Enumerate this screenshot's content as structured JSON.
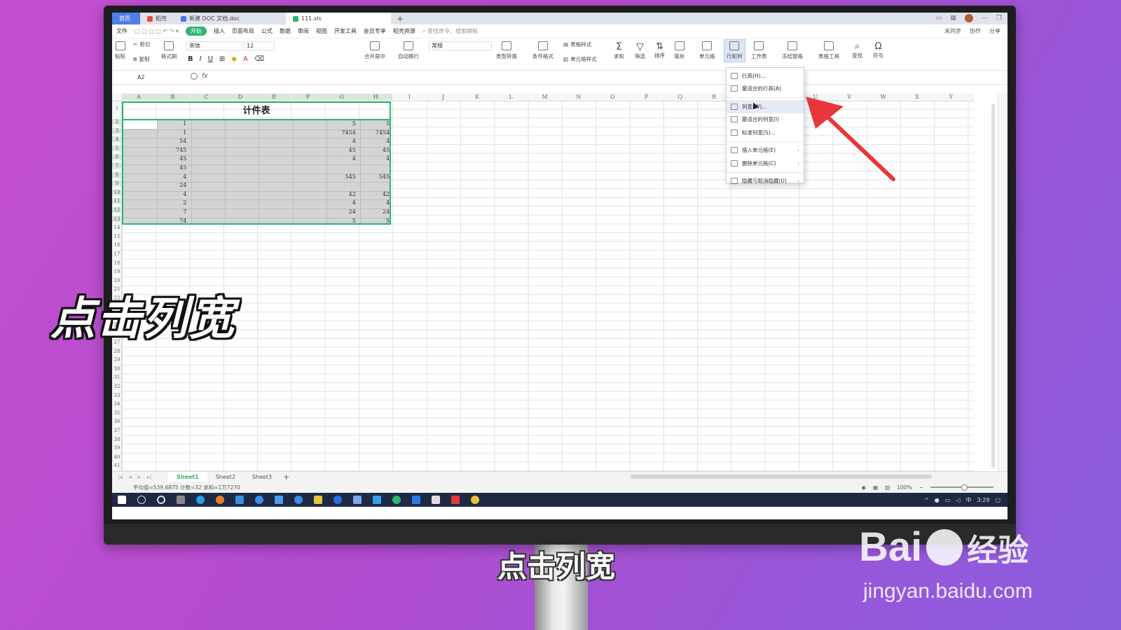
{
  "tabs": [
    {
      "label": "首页",
      "kind": "home"
    },
    {
      "label": "稻壳",
      "kind": "normal"
    },
    {
      "label": "新建 DOC 文档.doc",
      "kind": "normal"
    },
    {
      "label": "111.xls",
      "kind": "active"
    }
  ],
  "menu": {
    "file": "文件",
    "items": [
      "开始",
      "插入",
      "页面布局",
      "公式",
      "数据",
      "审阅",
      "视图",
      "开发工具",
      "会员专享",
      "稻壳资源"
    ],
    "search": "查找命令、搜索模板",
    "right": [
      "未同步",
      "协作",
      "分享"
    ]
  },
  "ribbon": {
    "cut": "剪切",
    "paste": "粘贴",
    "copy": "复制",
    "format_painter": "格式刷",
    "font": "宋体",
    "size": "12",
    "merge": "合并居中",
    "wrap": "自动换行",
    "number_format": "常规",
    "type_convert": "类型转换",
    "cond_format": "条件格式",
    "table_style": "表格样式",
    "cell_style": "单元格样式",
    "sum": "求和",
    "filter": "筛选",
    "sort": "排序",
    "fill": "填充",
    "cell": "单元格",
    "rowcol": "行和列",
    "worksheet": "工作表",
    "freeze": "冻结窗格",
    "table_tools": "表格工具",
    "find": "查找",
    "symbol": "符号"
  },
  "formula": {
    "namebox": "A2",
    "fx": "fx"
  },
  "columns": [
    "A",
    "B",
    "C",
    "D",
    "E",
    "F",
    "G",
    "H",
    "I",
    "J",
    "K",
    "L",
    "M",
    "N",
    "O",
    "P",
    "Q",
    "R",
    "S",
    "T",
    "U",
    "V",
    "W",
    "X",
    "Y"
  ],
  "rows": [
    "1",
    "2",
    "3",
    "4",
    "5",
    "6",
    "7",
    "8",
    "9",
    "10",
    "11",
    "12",
    "13",
    "14",
    "15",
    "16",
    "17",
    "18",
    "19",
    "20",
    "21",
    "22",
    "23",
    "24",
    "25",
    "26",
    "27",
    "28",
    "29",
    "30",
    "31",
    "32",
    "33",
    "34",
    "35",
    "36",
    "37",
    "38",
    "39",
    "40",
    "41"
  ],
  "table_title": "计件表",
  "cells_b": [
    "1",
    "1",
    "54",
    "745",
    "45",
    "45",
    "4",
    "24",
    "4",
    "2",
    "7",
    "74"
  ],
  "cells_g": [
    "5",
    "7454",
    "4",
    "45",
    "4",
    "",
    "545",
    "",
    "42",
    "4",
    "24",
    "5"
  ],
  "cells_h": [
    "5",
    "7454",
    "4",
    "45",
    "4",
    "",
    "545",
    "",
    "42",
    "4",
    "24",
    "5"
  ],
  "dropdown": [
    {
      "label": "行高(H)...",
      "hover": false,
      "sub": false
    },
    {
      "label": "最适合的行高(A)",
      "hover": false,
      "sub": false
    },
    {
      "label": "列宽(W)...",
      "hover": true,
      "sub": false
    },
    {
      "label": "最适合的列宽(I)",
      "hover": false,
      "sub": false
    },
    {
      "label": "标准列宽(S)...",
      "hover": false,
      "sub": false
    },
    {
      "label": "插入单元格(E)",
      "hover": false,
      "sub": true
    },
    {
      "label": "删除单元格(C)",
      "hover": false,
      "sub": true
    },
    {
      "label": "隐藏与取消隐藏(U)",
      "hover": false,
      "sub": true
    }
  ],
  "sheets": [
    "Sheet1",
    "Sheet2",
    "Sheet3"
  ],
  "status": {
    "text": "平均值=539.6875  计数=32  求和=1万7270",
    "zoom": "100%"
  },
  "clock": "3:29",
  "caption_big": "点击列宽",
  "caption_sub": "点击列宽",
  "watermark": {
    "brand": "Bai",
    "brand2": "经验",
    "url": "jingyan.baidu.com"
  },
  "colors": {
    "accent": "#2bb673",
    "arrow": "#e8373a",
    "home_tab": "#4f7ee8"
  }
}
